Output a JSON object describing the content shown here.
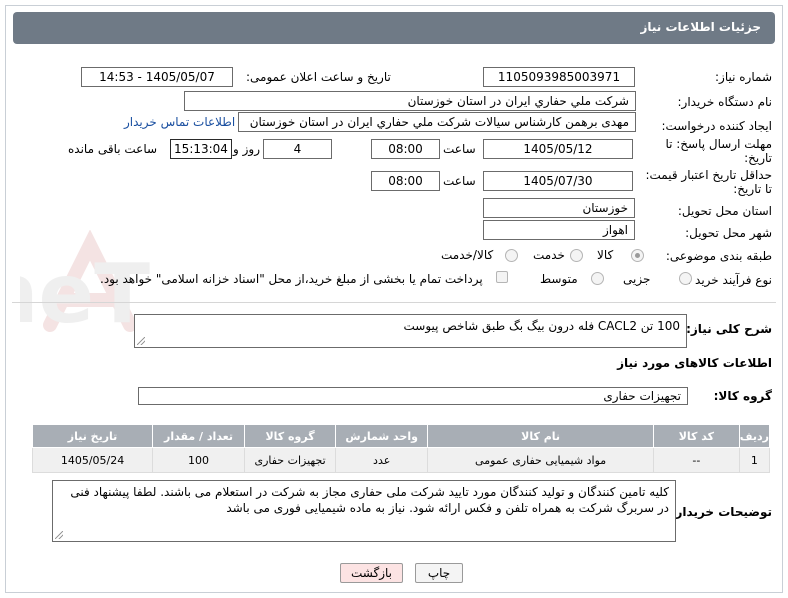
{
  "header": {
    "title": "جزئیات اطلاعات نیاز"
  },
  "fields": {
    "need_number": {
      "label": "شماره نیاز:",
      "value": "1105093985003971"
    },
    "announce_datetime": {
      "label": "تاریخ و ساعت اعلان عمومی:",
      "value": "1405/05/07 - 14:53"
    },
    "buyer_org": {
      "label": "نام دستگاه خریدار:",
      "value": "شرکت ملي حفاري ايران در استان خوزستان"
    },
    "requester": {
      "label": "ایجاد کننده درخواست:",
      "value": "مهدی برهمن کارشناس سیالات شرکت ملي حفاري ايران در استان خوزستان",
      "contact_link": "اطلاعات تماس خریدار"
    },
    "reply_deadline": {
      "label_line1": "مهلت ارسال پاسخ: تا",
      "label_line2": "تاریخ:",
      "date": "1405/05/12",
      "time_label": "ساعت",
      "time": "08:00",
      "days": "4",
      "days_label": "روز و",
      "remaining": "15:13:04",
      "remaining_label": "ساعت باقی مانده"
    },
    "price_validity": {
      "label_line1": "حداقل تاریخ اعتبار قیمت:",
      "label_line2": "تا تاریخ:",
      "date": "1405/07/30",
      "time_label": "ساعت",
      "time": "08:00"
    },
    "delivery_province": {
      "label": "استان محل تحویل:",
      "value": "خوزستان"
    },
    "delivery_city": {
      "label": "شهر محل تحویل:",
      "value": "اهواز"
    },
    "category": {
      "label": "طبقه بندی موضوعی:",
      "options": [
        "کالا",
        "خدمت",
        "کالا/خدمت"
      ],
      "selected": "کالا"
    },
    "purchase_process": {
      "label": "نوع فرآیند خرید :",
      "options": [
        "جزیی",
        "متوسط"
      ],
      "selected": "جزیی",
      "note": "پرداخت تمام یا بخشی از مبلغ خرید،از محل \"اسناد خزانه اسلامی\" خواهد بود."
    }
  },
  "description": {
    "label": "شرح کلی نیاز:",
    "value": "100 تن CACL2 فله درون بیگ بگ طبق شاخص پیوست"
  },
  "goods_section": {
    "title": "اطلاعات کالاهای مورد نیاز",
    "group_label": "گروه کالا:",
    "group_value": "تجهیزات حفاری"
  },
  "table": {
    "headers": [
      "ردیف",
      "کد کالا",
      "نام کالا",
      "واحد شمارش",
      "گروه کالا",
      "تعداد / مقدار",
      "تاریخ نیاز"
    ],
    "rows": [
      [
        "1",
        "--",
        "مواد شیمیایی حفاری عمومی",
        "عدد",
        "تجهیزات حفاری",
        "100",
        "1405/05/24"
      ]
    ]
  },
  "buyer_notes": {
    "label": "توضیحات خریدار:",
    "value": "کلیه تامین کنندگان و تولید کنندگان مورد تایید شرکت ملی حفاری مجاز به شرکت در استعلام می باشند. لطفا پیشنهاد فنی در سربرگ شرکت به همراه تلفن و فکس ارائه شود. نیاز به ماده شیمیایی فوری می باشد"
  },
  "buttons": {
    "print": "چاپ",
    "back": "بازگشت"
  },
  "watermark": {
    "text": "AriaTender.neT"
  },
  "colors": {
    "header": "#6f7a86",
    "table_header": "#a8aeb5",
    "back_button": "#fce3e3",
    "link": "#1a4fa0"
  }
}
